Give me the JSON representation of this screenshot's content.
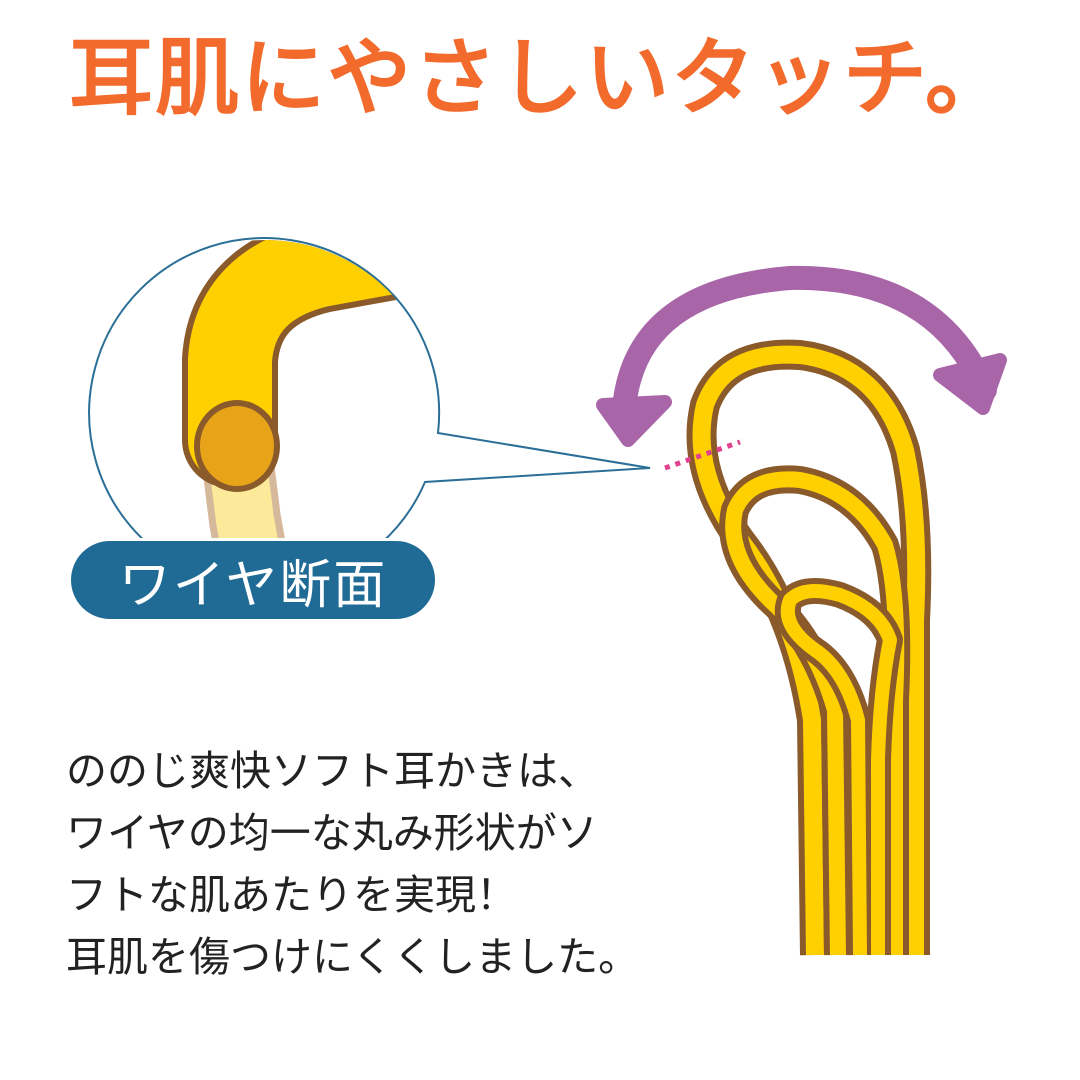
{
  "headline": "耳肌にやさしいタッチ。",
  "section_label": "ワイヤ断面",
  "description_lines": [
    "ののじ爽快ソフト耳かきは、",
    "ワイヤの均一な丸み形状がソ",
    "フトな肌あたりを実現！",
    "耳肌を傷つけにくくしました。"
  ],
  "colors": {
    "headline": "#f26a2c",
    "wire_fill": "#ffd000",
    "wire_outline": "#8a5a2b",
    "wire_core": "#e8a418",
    "callout_line": "#2b6f97",
    "label_bg": "#1f6b95",
    "arrow": "#a866a8",
    "cut_line": "#e0418e"
  },
  "icons": {
    "flex_arrow": "double-headed-curved-arrow",
    "cross_section": "magnified-wire-cross-section"
  }
}
